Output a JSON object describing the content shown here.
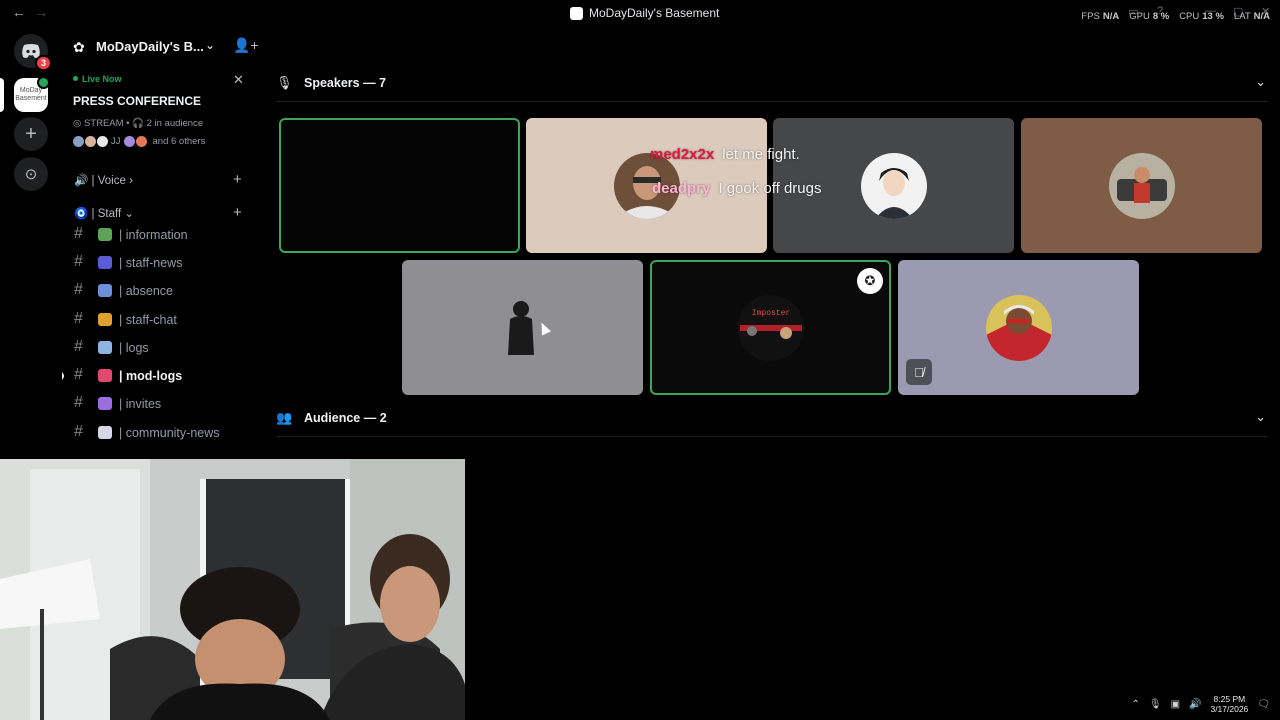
{
  "titlebar": {
    "back": "←",
    "forward": "→",
    "title": "MoDayDaily's Basement",
    "perf": [
      {
        "key": "FPS",
        "value": "N/A"
      },
      {
        "key": "GPU",
        "value": "8 %"
      },
      {
        "key": "CPU",
        "value": "13 %"
      },
      {
        "key": "LAT",
        "value": "N/A"
      }
    ]
  },
  "rail": {
    "home_badge": "3",
    "server_label": "MoDay Basement"
  },
  "sidebar": {
    "server_name": "MoDayDaily's B...",
    "live": {
      "label": "Live Now",
      "title": "PRESS CONFERENCE",
      "meta": "STREAM • 🎧 2 in audience",
      "avatars_text": "JJ",
      "others": "and 6 others"
    },
    "categories": {
      "voice": "| Voice",
      "staff": "| Staff"
    },
    "channels": [
      {
        "name": "| information",
        "color": "#5fa35a"
      },
      {
        "name": "| staff-news",
        "color": "#5b5bd6"
      },
      {
        "name": "| absence",
        "color": "#6d8fd8"
      },
      {
        "name": "| staff-chat",
        "color": "#e0a030"
      },
      {
        "name": "| logs",
        "color": "#8fb4e0"
      },
      {
        "name": "| mod-logs",
        "color": "#e0486f"
      },
      {
        "name": "| invites",
        "color": "#9b6ee0"
      },
      {
        "name": "| community-news",
        "color": "#d6d6e8"
      }
    ]
  },
  "stage": {
    "speakers_title": "Speakers — 7",
    "audience_title": "Audience — 2",
    "tiles_row1": [
      {
        "bg": "#050505",
        "speaking": true,
        "avatar": ""
      },
      {
        "bg": "#dccbbd",
        "speaking": false,
        "avatar": "face"
      },
      {
        "bg": "#464749",
        "speaking": false,
        "avatar": "anime"
      },
      {
        "bg": "#7f5c45",
        "speaking": false,
        "avatar": "car"
      }
    ],
    "tiles_row2": [
      {
        "bg": "#8f8f92",
        "speaking": false,
        "avatar": "figure"
      },
      {
        "bg": "#0a0a0a",
        "speaking": true,
        "avatar": "imposter"
      },
      {
        "bg": "#9b9ab0",
        "speaking": false,
        "avatar": "spider"
      }
    ],
    "chat": [
      {
        "user": "med2x2x",
        "msg": "let me fight."
      },
      {
        "user": "deadpry",
        "msg": "I gook off drugs"
      }
    ],
    "imposter_text": "Imposter"
  },
  "tray": {
    "time": "8:25 PM",
    "date": "3/17/2026"
  }
}
